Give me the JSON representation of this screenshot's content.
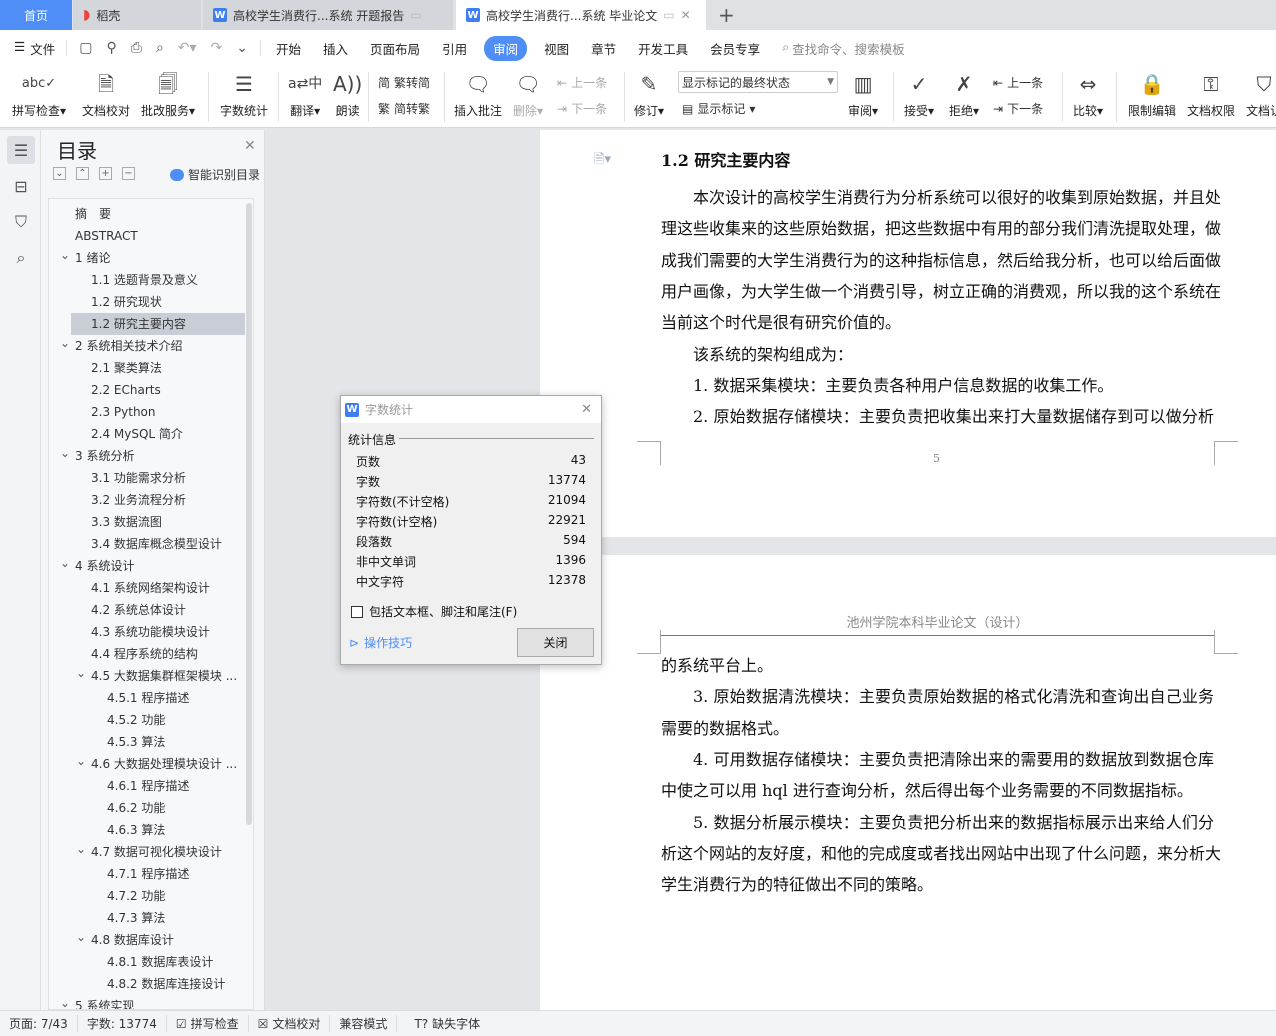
{
  "tabs": [
    {
      "label": "首页"
    },
    {
      "label": "稻壳"
    },
    {
      "label": "高校学生消费行...系统 开题报告"
    },
    {
      "label": "高校学生消费行...系统 毕业论文"
    }
  ],
  "menu": {
    "file": "文件",
    "items": [
      "开始",
      "插入",
      "页面布局",
      "引用",
      "审阅",
      "视图",
      "章节",
      "开发工具",
      "会员专享"
    ],
    "active": "审阅",
    "search_placeholder": "查找命令、搜索模板"
  },
  "ribbon": {
    "spell": "拼写检查",
    "proof": "文档校对",
    "correct": "批改服务",
    "wordcount": "字数统计",
    "translate": "翻译",
    "read": "朗读",
    "trad2simp": "繁转简",
    "simp2trad": "简转繁",
    "insert_comment": "插入批注",
    "delete": "删除",
    "prev": "上一条",
    "next": "下一条",
    "revise": "修订",
    "markup_state": "显示标记的最终状态",
    "show_markup": "显示标记",
    "review": "审阅",
    "accept": "接受",
    "reject": "拒绝",
    "prev2": "上一条",
    "next2": "下一条",
    "compare": "比较",
    "restrict": "限制编辑",
    "permission": "文档权限",
    "cert": "文档认"
  },
  "toc": {
    "title": "目录",
    "smart": "智能识别目录",
    "items": [
      {
        "text": "摘　要",
        "level": 0
      },
      {
        "text": "ABSTRACT",
        "level": 0
      },
      {
        "text": "1  绪论",
        "level": 0,
        "expanded": true
      },
      {
        "text": "1.1 选题背景及意义",
        "level": 1
      },
      {
        "text": "1.2 研究现状",
        "level": 1
      },
      {
        "text": "1.2 研究主要内容",
        "level": 1,
        "selected": true
      },
      {
        "text": "2  系统相关技术介绍",
        "level": 0,
        "expanded": true
      },
      {
        "text": "2.1 聚类算法",
        "level": 1
      },
      {
        "text": "2.2 ECharts",
        "level": 1
      },
      {
        "text": "2.3 Python",
        "level": 1
      },
      {
        "text": "2.4 MySQL 简介",
        "level": 1
      },
      {
        "text": "3  系统分析",
        "level": 0,
        "expanded": true
      },
      {
        "text": "3.1  功能需求分析",
        "level": 1
      },
      {
        "text": "3.2  业务流程分析",
        "level": 1
      },
      {
        "text": "3.3  数据流图",
        "level": 1
      },
      {
        "text": "3.4  数据库概念模型设计",
        "level": 1
      },
      {
        "text": "4  系统设计",
        "level": 0,
        "expanded": true
      },
      {
        "text": "4.1  系统网络架构设计",
        "level": 1
      },
      {
        "text": "4.2  系统总体设计",
        "level": 1
      },
      {
        "text": "4.3  系统功能模块设计",
        "level": 1
      },
      {
        "text": "4.4  程序系统的结构",
        "level": 1
      },
      {
        "text": "4.5  大数据集群框架模块 ...",
        "level": 1,
        "expanded": true
      },
      {
        "text": "4.5.1  程序描述",
        "level": 2
      },
      {
        "text": "4.5.2  功能",
        "level": 2
      },
      {
        "text": "4.5.3  算法",
        "level": 2
      },
      {
        "text": "4.6  大数据处理模块设计 ...",
        "level": 1,
        "expanded": true
      },
      {
        "text": "4.6.1  程序描述",
        "level": 2
      },
      {
        "text": "4.6.2  功能",
        "level": 2
      },
      {
        "text": "4.6.3  算法",
        "level": 2
      },
      {
        "text": "4.7  数据可视化模块设计",
        "level": 1,
        "expanded": true
      },
      {
        "text": "4.7.1  程序描述",
        "level": 2
      },
      {
        "text": "4.7.2  功能",
        "level": 2
      },
      {
        "text": "4.7.3  算法",
        "level": 2
      },
      {
        "text": "4.8  数据库设计",
        "level": 1,
        "expanded": true
      },
      {
        "text": "4.8.1  数据库表设计",
        "level": 2
      },
      {
        "text": "4.8.2  数据库连接设计",
        "level": 2
      },
      {
        "text": "5  系统实现",
        "level": 0,
        "expanded": true
      }
    ]
  },
  "document": {
    "page1": {
      "heading": "1.2 研究主要内容",
      "lines": [
        {
          "text": "本次设计的高校学生消费行为分析系统可以很好的收集到原始数据，并且处",
          "indent": true,
          "full": true
        },
        {
          "text": "理这些收集来的这些原始数据，把这些数据中有用的部分我们清洗提取处理，做",
          "full": true
        },
        {
          "text": "成我们需要的大学生消费行为的这种指标信息，然后给我分析，也可以给后面做",
          "full": true
        },
        {
          "text": "用户画像，为大学生做一个消费引导，树立正确的消费观，所以我的这个系统在",
          "full": true
        },
        {
          "text": "当前这个时代是很有研究价值的。"
        },
        {
          "text": "该系统的架构组成为：",
          "indent": true
        },
        {
          "text": "1.  数据采集模块：主要负责各种用户信息数据的收集工作。",
          "indent": true
        },
        {
          "text": "2.  原始数据存储模块：主要负责把收集出来打大量数据储存到可以做分析",
          "indent": true,
          "full": true
        }
      ],
      "page_number": "5"
    },
    "page2": {
      "header": "池州学院本科毕业论文（设计）",
      "lines": [
        {
          "text": "的系统平台上。"
        },
        {
          "text": "3.  原始数据清洗模块：主要负责原始数据的格式化清洗和查询出自己业务",
          "indent": true,
          "full": true
        },
        {
          "text": "需要的数据格式。"
        },
        {
          "text": "4.  可用数据存储模块：主要负责把清除出来的需要用的数据放到数据仓库",
          "indent": true,
          "full": true
        },
        {
          "text": "中使之可以用 hql 进行查询分析，然后得出每个业务需要的不同数据指标。"
        },
        {
          "text": "5.  数据分析展示模块：主要负责把分析出来的数据指标展示出来给人们分",
          "indent": true,
          "full": true
        },
        {
          "text": "析这个网站的友好度，和他的完成度或者找出网站中出现了什么问题，来分析大",
          "full": true
        },
        {
          "text": "学生消费行为的特征做出不同的策略。"
        }
      ]
    }
  },
  "dialog": {
    "title": "字数统计",
    "section": "统计信息",
    "rows": [
      {
        "label": "页数",
        "value": "43"
      },
      {
        "label": "字数",
        "value": "13774"
      },
      {
        "label": "字符数(不计空格)",
        "value": "21094"
      },
      {
        "label": "字符数(计空格)",
        "value": "22921"
      },
      {
        "label": "段落数",
        "value": "594"
      },
      {
        "label": "非中文单词",
        "value": "1396"
      },
      {
        "label": "中文字符",
        "value": "12378"
      }
    ],
    "checkbox": "包括文本框、脚注和尾注(F)",
    "checked": false,
    "tips": "操作技巧",
    "close": "关闭"
  },
  "status": {
    "page": "页面: 7/43",
    "words": "字数: 13774",
    "spell": "拼写检查",
    "proof": "文档校对",
    "compat": "兼容模式",
    "missing_font": "缺失字体"
  },
  "colors": {
    "accent": "#4f8ef7",
    "selected_toc": "#c9ced6"
  }
}
